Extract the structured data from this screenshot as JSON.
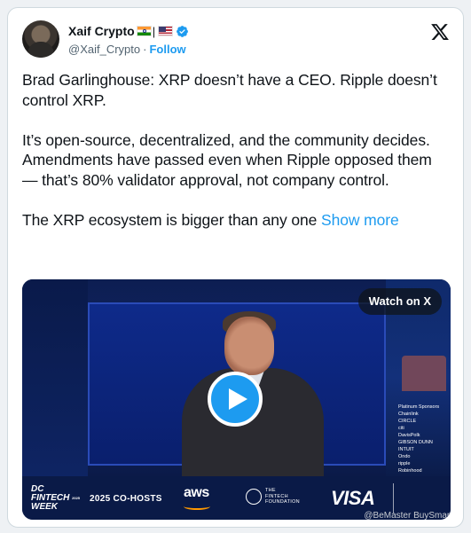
{
  "author": {
    "display_name": "Xaif Crypto",
    "flag_separator": "|",
    "handle": "@Xaif_Crypto",
    "dot": "·",
    "follow_label": "Follow",
    "icons": [
      "india-flag-icon",
      "us-flag-icon",
      "verified-badge-icon",
      "x-logo-icon"
    ]
  },
  "tweet": {
    "lines": [
      "Brad Garlinghouse: XRP doesn’t have a CEO. Ripple doesn’t control XRP.",
      "",
      "It’s open-source, decentralized, and the community decides.",
      "Amendments have passed even when Ripple opposed them — that’s 80% validator approval, not company control.",
      ""
    ],
    "last_line": "The XRP ecosystem is bigger than any one",
    "show_more_label": "Show more"
  },
  "media": {
    "watch_label": "Watch on X",
    "play_icon": "play-icon",
    "banner": {
      "event_line1": "DC",
      "event_line2": "FINTECH",
      "event_line3": "WEEK",
      "event_year": "2025",
      "cohosts": "2025 CO-HOSTS",
      "aws": "aws",
      "foundation_line1": "THE",
      "foundation_line2": "FINTECH",
      "foundation_line3": "FOUNDATION",
      "visa": "VISA"
    },
    "sponsors": [
      "Platinum Sponsors",
      "Chainlink",
      "CIRCLE",
      "citi",
      "DavisPolk",
      "GIBSON DUNN",
      "INTUIT",
      "Ondo",
      "ripple",
      "Robinhood"
    ]
  },
  "watermark": "@BeMaster BuySmart",
  "colors": {
    "accent": "#1d9bf0",
    "text": "#0f1419",
    "muted": "#536471"
  }
}
